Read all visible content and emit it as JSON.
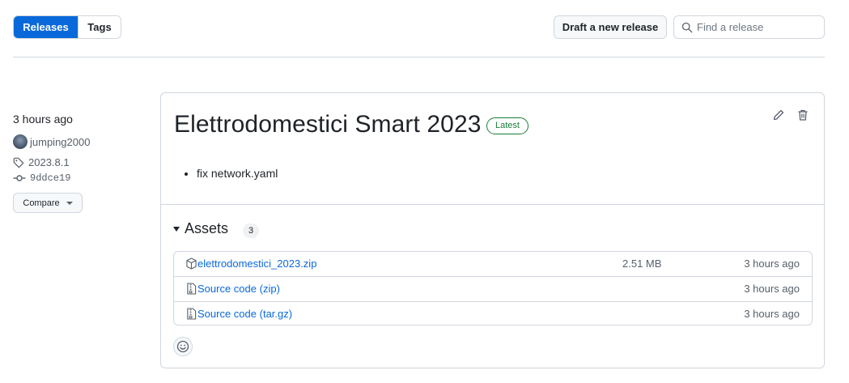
{
  "nav": {
    "tabs": [
      {
        "label": "Releases",
        "active": true
      },
      {
        "label": "Tags",
        "active": false
      }
    ],
    "draft_button": "Draft a new release",
    "search_placeholder": "Find a release"
  },
  "release": {
    "time_ago": "3 hours ago",
    "author": "jumping2000",
    "tag": "2023.8.1",
    "commit": "9ddce19",
    "compare_label": "Compare",
    "title": "Elettrodomestici Smart 2023",
    "badge": "Latest",
    "notes": [
      "fix network.yaml"
    ],
    "assets_label": "Assets",
    "assets_count": "3",
    "assets": [
      {
        "icon": "package-icon",
        "name": "elettrodomestici_2023.zip",
        "sub": "",
        "size": "2.51 MB",
        "time": "3 hours ago"
      },
      {
        "icon": "file-zip-icon",
        "name": "Source code",
        "sub": "(zip)",
        "size": "",
        "time": "3 hours ago"
      },
      {
        "icon": "file-zip-icon",
        "name": "Source code",
        "sub": "(tar.gz)",
        "size": "",
        "time": "3 hours ago"
      }
    ]
  },
  "colors": {
    "accent": "#0969da",
    "latest_green": "#1a7f37",
    "border": "#d0d7de",
    "muted": "#57606a"
  }
}
